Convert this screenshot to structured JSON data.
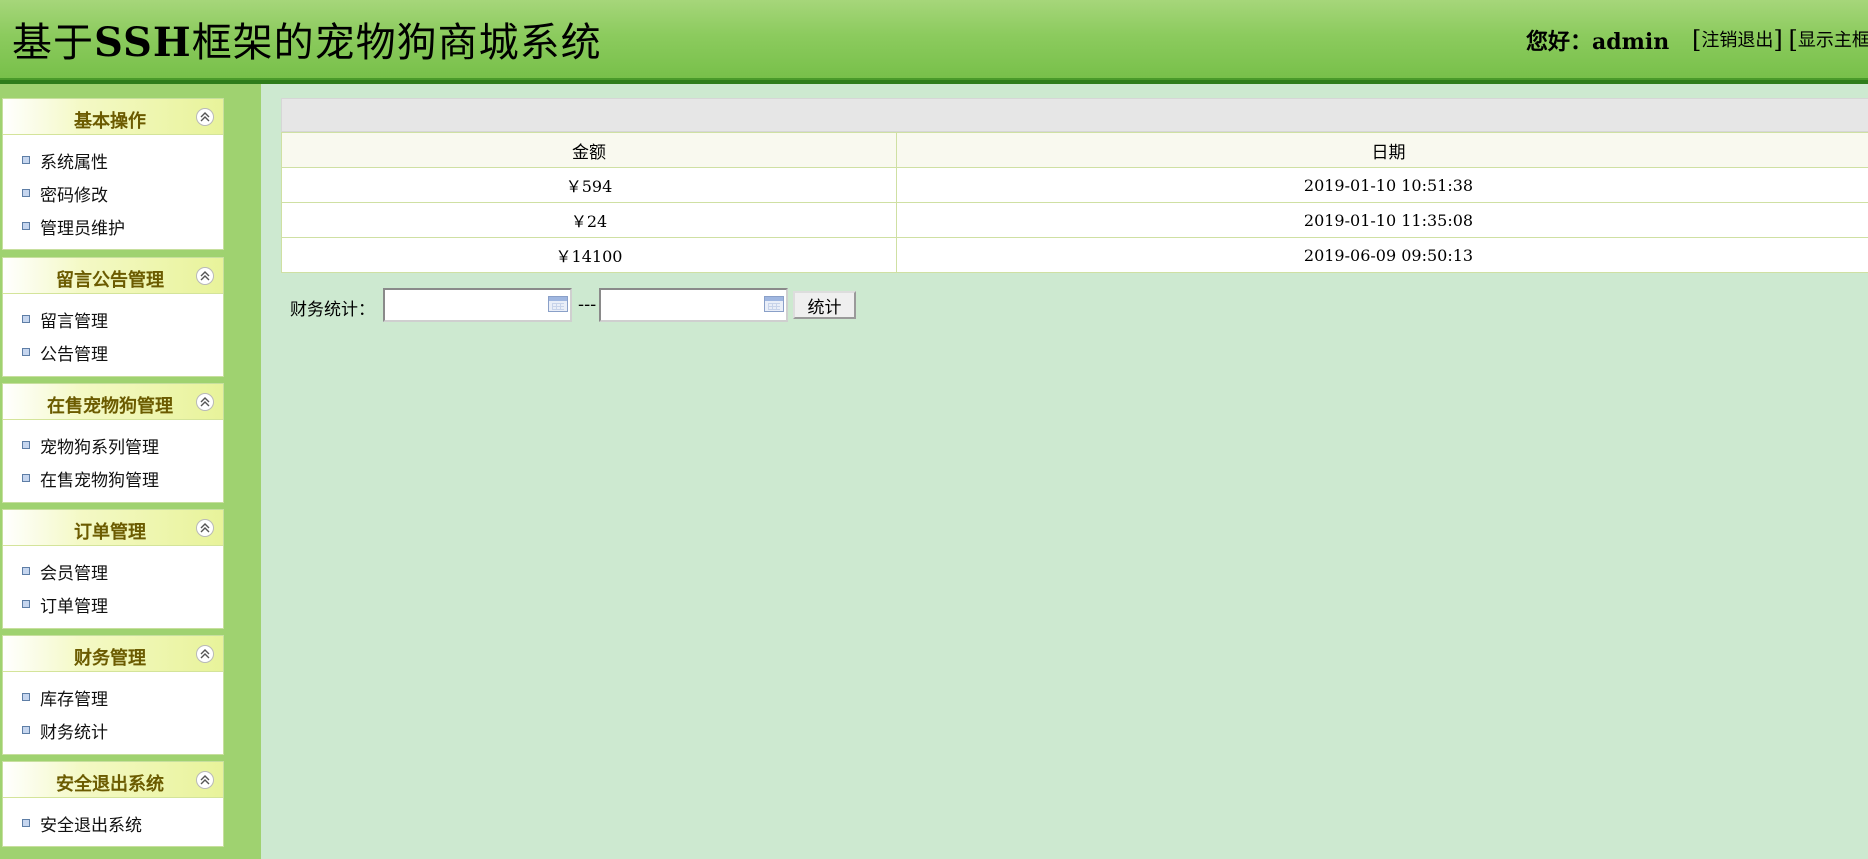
{
  "header": {
    "title_prefix": "基于",
    "title_bold": "SSH",
    "title_suffix": "框架的宠物狗商城系统",
    "greeting": "您好：admin",
    "links": {
      "logout": "注销退出",
      "main_frame": "显示主框"
    }
  },
  "sidebar": {
    "panels": [
      {
        "title": "基本操作",
        "items": [
          "系统属性",
          "密码修改",
          "管理员维护"
        ]
      },
      {
        "title": "留言公告管理",
        "items": [
          "留言管理",
          "公告管理"
        ]
      },
      {
        "title": "在售宠物狗管理",
        "items": [
          "宠物狗系列管理",
          "在售宠物狗管理"
        ]
      },
      {
        "title": "订单管理",
        "items": [
          "会员管理",
          "订单管理"
        ]
      },
      {
        "title": "财务管理",
        "items": [
          "库存管理",
          "财务统计"
        ]
      },
      {
        "title": "安全退出系统",
        "items": [
          "安全退出系统"
        ]
      }
    ]
  },
  "main": {
    "table": {
      "headers": [
        "金额",
        "日期"
      ],
      "rows": [
        [
          "￥594",
          "2019-01-10 10:51:38"
        ],
        [
          "￥24",
          "2019-01-10 11:35:08"
        ],
        [
          "￥14100",
          "2019-06-09 09:50:13"
        ]
      ]
    },
    "stats": {
      "label": "财务统计：",
      "start_value": "",
      "end_value": "",
      "separator": "---",
      "button": "统计"
    }
  },
  "colors": {
    "header_green": "#8ccb5e",
    "sidebar_green": "#9fd270",
    "content_bg": "#cde9d0",
    "panel_title": "#6b5b00"
  }
}
